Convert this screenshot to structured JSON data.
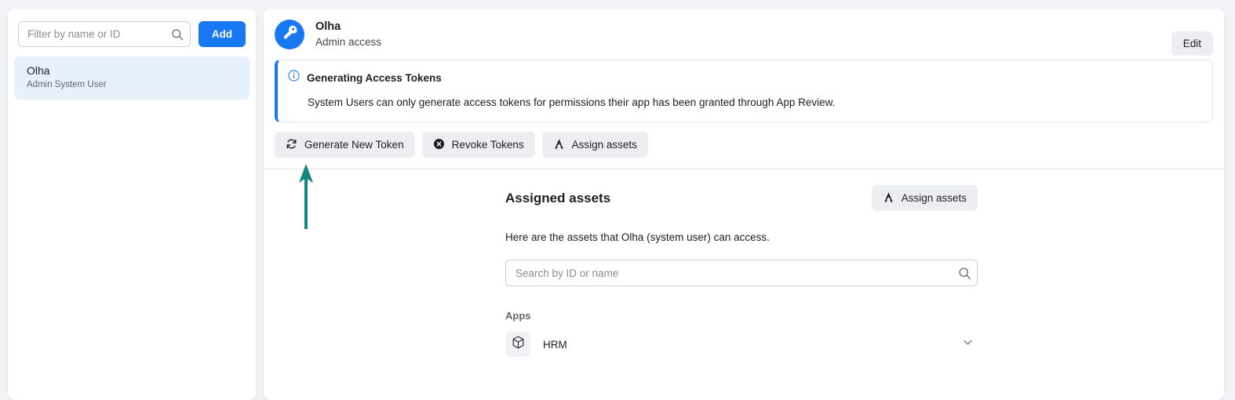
{
  "colors": {
    "brand_blue": "#1877f2",
    "page_bg": "#f0f2f5",
    "selected_item_bg": "#e7f0fd",
    "button_bg": "#eceef1",
    "annotation_arrow": "#10867f"
  },
  "sidebar": {
    "filter": {
      "placeholder": "Filter by name or ID",
      "value": "",
      "icon": "search-icon"
    },
    "add_button": {
      "label": "Add"
    },
    "items": [
      {
        "name": "Olha",
        "subtitle": "Admin System User",
        "selected": true
      }
    ]
  },
  "header": {
    "avatar_icon": "key-icon",
    "title": "Olha",
    "subtitle": "Admin access",
    "edit_button": {
      "label": "Edit"
    }
  },
  "info_banner": {
    "icon": "info-circle-icon",
    "title": "Generating Access Tokens",
    "body": "System Users can only generate access tokens for permissions their app has been granted through App Review."
  },
  "actions": [
    {
      "label": "Generate New Token",
      "icon": "refresh-icon"
    },
    {
      "label": "Revoke Tokens",
      "icon": "x-circle-icon"
    },
    {
      "label": "Assign assets",
      "icon": "assets-triangle-icon"
    }
  ],
  "assets": {
    "title": "Assigned assets",
    "assign_button": {
      "label": "Assign assets",
      "icon": "assets-triangle-icon"
    },
    "description": "Here are the assets that Olha (system user) can access.",
    "search": {
      "placeholder": "Search by ID or name",
      "value": "",
      "icon": "search-icon"
    },
    "group_label": "Apps",
    "apps": [
      {
        "name": "HRM",
        "icon": "cube-icon",
        "expand_icon": "chevron-down-icon"
      }
    ]
  },
  "annotation": {
    "type": "arrow",
    "direction": "up",
    "points_to": "Generate New Token"
  }
}
